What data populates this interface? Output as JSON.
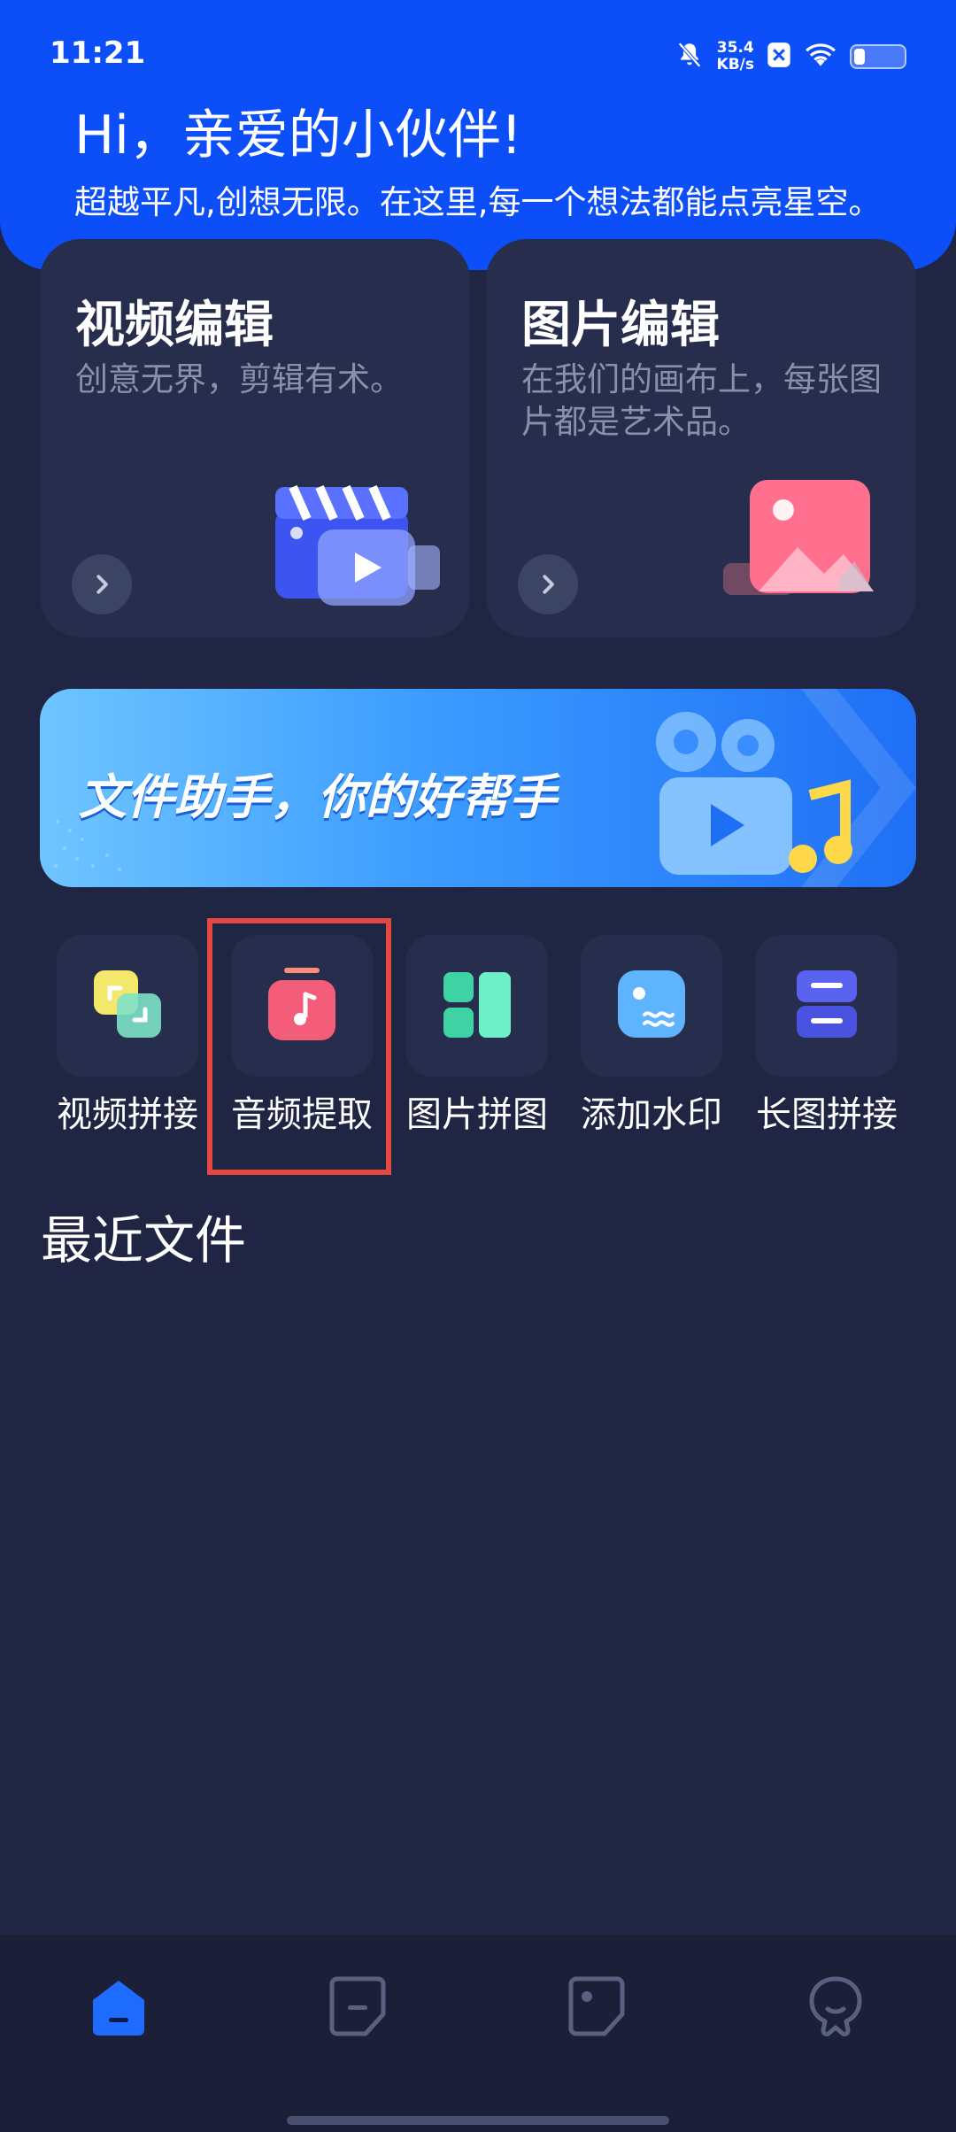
{
  "status_bar": {
    "time": "11:21",
    "net_speed_value": "35.4",
    "net_speed_unit": "KB/s",
    "icons": [
      "bell-muted-icon",
      "notification-x-icon",
      "wifi-icon",
      "battery-icon"
    ],
    "battery_level": 0.3
  },
  "header": {
    "greeting": "Hi，亲爱的小伙伴!",
    "subtitle": "超越平凡,创想无限。在这里,每一个想法都能点亮星空。"
  },
  "cards": [
    {
      "title": "视频编辑",
      "desc": "创意无界，剪辑有术。",
      "icon": "video-clapper-icon"
    },
    {
      "title": "图片编辑",
      "desc": "在我们的画布上，每张图片都是艺术品。",
      "icon": "image-icon"
    }
  ],
  "banner": {
    "text": "文件助手，你的好帮手",
    "icon": "video-camera-music-icon"
  },
  "tools": [
    {
      "label": "视频拼接",
      "icon": "video-merge-icon",
      "highlighted": false
    },
    {
      "label": "音频提取",
      "icon": "audio-extract-icon",
      "highlighted": true
    },
    {
      "label": "图片拼图",
      "icon": "image-collage-icon",
      "highlighted": false
    },
    {
      "label": "添加水印",
      "icon": "watermark-icon",
      "highlighted": false
    },
    {
      "label": "长图拼接",
      "icon": "long-image-stitch-icon",
      "highlighted": false
    }
  ],
  "recent": {
    "title": "最近文件"
  },
  "bottom_nav": {
    "items": [
      {
        "icon": "home-icon",
        "active": true
      },
      {
        "icon": "tools-icon",
        "active": false
      },
      {
        "icon": "gallery-icon",
        "active": false
      },
      {
        "icon": "profile-icon",
        "active": false
      }
    ]
  },
  "colors": {
    "header_blue": "#0c4ef7",
    "background": "#1f2542",
    "card": "#272e4d",
    "highlight_red": "#e64740",
    "nav_active": "#1e6bff"
  }
}
